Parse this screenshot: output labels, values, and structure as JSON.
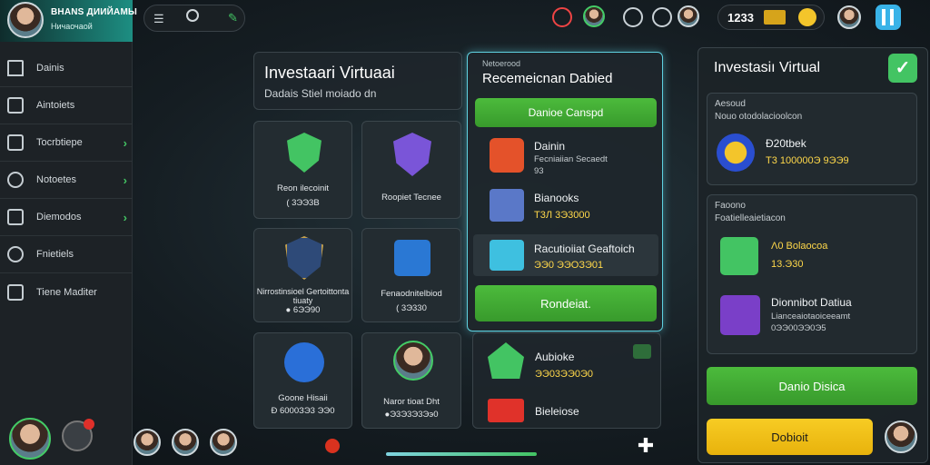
{
  "profile": {
    "name": "BHANS ДИИЙАМЫ",
    "subtitle": "Ничаочаой"
  },
  "sidebar": {
    "items": [
      {
        "label": "Dainis",
        "icon": "home-icon",
        "chevron": ""
      },
      {
        "label": "Aintoiets",
        "icon": "list-icon",
        "chevron": ""
      },
      {
        "label": "Tocrbtiepe",
        "icon": "document-icon",
        "chevron": "›"
      },
      {
        "label": "Notoetes",
        "icon": "scissors-icon",
        "chevron": "›"
      },
      {
        "label": "Diemodos",
        "icon": "folder-icon",
        "chevron": "›"
      },
      {
        "label": "Fnietiels",
        "icon": "info-icon",
        "chevron": ""
      },
      {
        "label": "Tiene Maditer",
        "icon": "terminal-icon",
        "chevron": ""
      }
    ]
  },
  "topbar": {
    "coins": "1233",
    "badge_count": "1"
  },
  "left_panel": {
    "title": "Investaari Virtuaai",
    "subtitle": "Dadais Stiel moiado dn",
    "tiles": [
      {
        "label": "Reon ilecoinit",
        "value": "( 3ЭЭ3В",
        "icon": "shield-check-icon"
      },
      {
        "label": "Roopiet Tecnee",
        "value": "",
        "icon": "shield-gem-icon"
      },
      {
        "label": "Nirrostinsioel Gertoittonta tiuaty",
        "value": "● 6ЭЭ90",
        "icon": "shield-box-icon"
      },
      {
        "label": "Fenaodnitelbiod",
        "value": "( 3Э330",
        "icon": "chart-icon"
      },
      {
        "label": "Goone Hisaii",
        "value": "Ð 6000ЗЭ3 ЭЭ0",
        "icon": "plane-icon"
      },
      {
        "label": "Naror tioat Dht",
        "value": "●Э3Э3Э3Ээ0",
        "icon": "person-icon"
      }
    ]
  },
  "mid_panel": {
    "tag": "Netoerood",
    "title": "Recemeicnan Dabied",
    "top_button": "Danioe Canspd",
    "rows": [
      {
        "title": "Dainin",
        "sub": "Fecniaiian Secaedt",
        "value": "93",
        "icon": "card-icon"
      },
      {
        "title": "Bianooks",
        "sub": "",
        "value": "Т3Л 3Э3000",
        "icon": "monitor-icon"
      },
      {
        "title": "Racutioiiat Geaftoich",
        "sub": "",
        "value": "ЭЭ0 ЭЭОЗЭ01",
        "icon": "device-icon"
      }
    ],
    "bottom_button": "Rondeiat."
  },
  "mid_extra": {
    "rows": [
      {
        "title": "Aubioke",
        "value": "ЭЭ03ЭЭ0Э0",
        "icon": "house-icon"
      },
      {
        "title": "Bieleiose",
        "value": "",
        "icon": "uno-icon"
      }
    ]
  },
  "right_panel": {
    "title": "Investasiı Virtual",
    "section1": {
      "tag": "Aesoud",
      "sub": "Nouo otodolacioolcon",
      "item_title": "Ð20tbek",
      "item_value": "Т3 100000Э 9ЭЭ9"
    },
    "section2": {
      "tag": "Faoono",
      "sub": "Foatielleaietiacon",
      "rows": [
        {
          "title": "Λ0 Bolaocoa",
          "value": "13.Э30",
          "icon": "chart-growth-icon"
        },
        {
          "title": "Dionnibot Datiua",
          "sub": "Lianceaiotaoiceeamt",
          "value": "0ЭЭ00ЭЭ0Э5",
          "icon": "apps-icon"
        }
      ]
    },
    "primary_button": "Danio Disica",
    "secondary_button": "Dobioit"
  },
  "colors": {
    "accent": "#43c463",
    "gold": "#f6c21c",
    "panel": "#1e262b"
  }
}
